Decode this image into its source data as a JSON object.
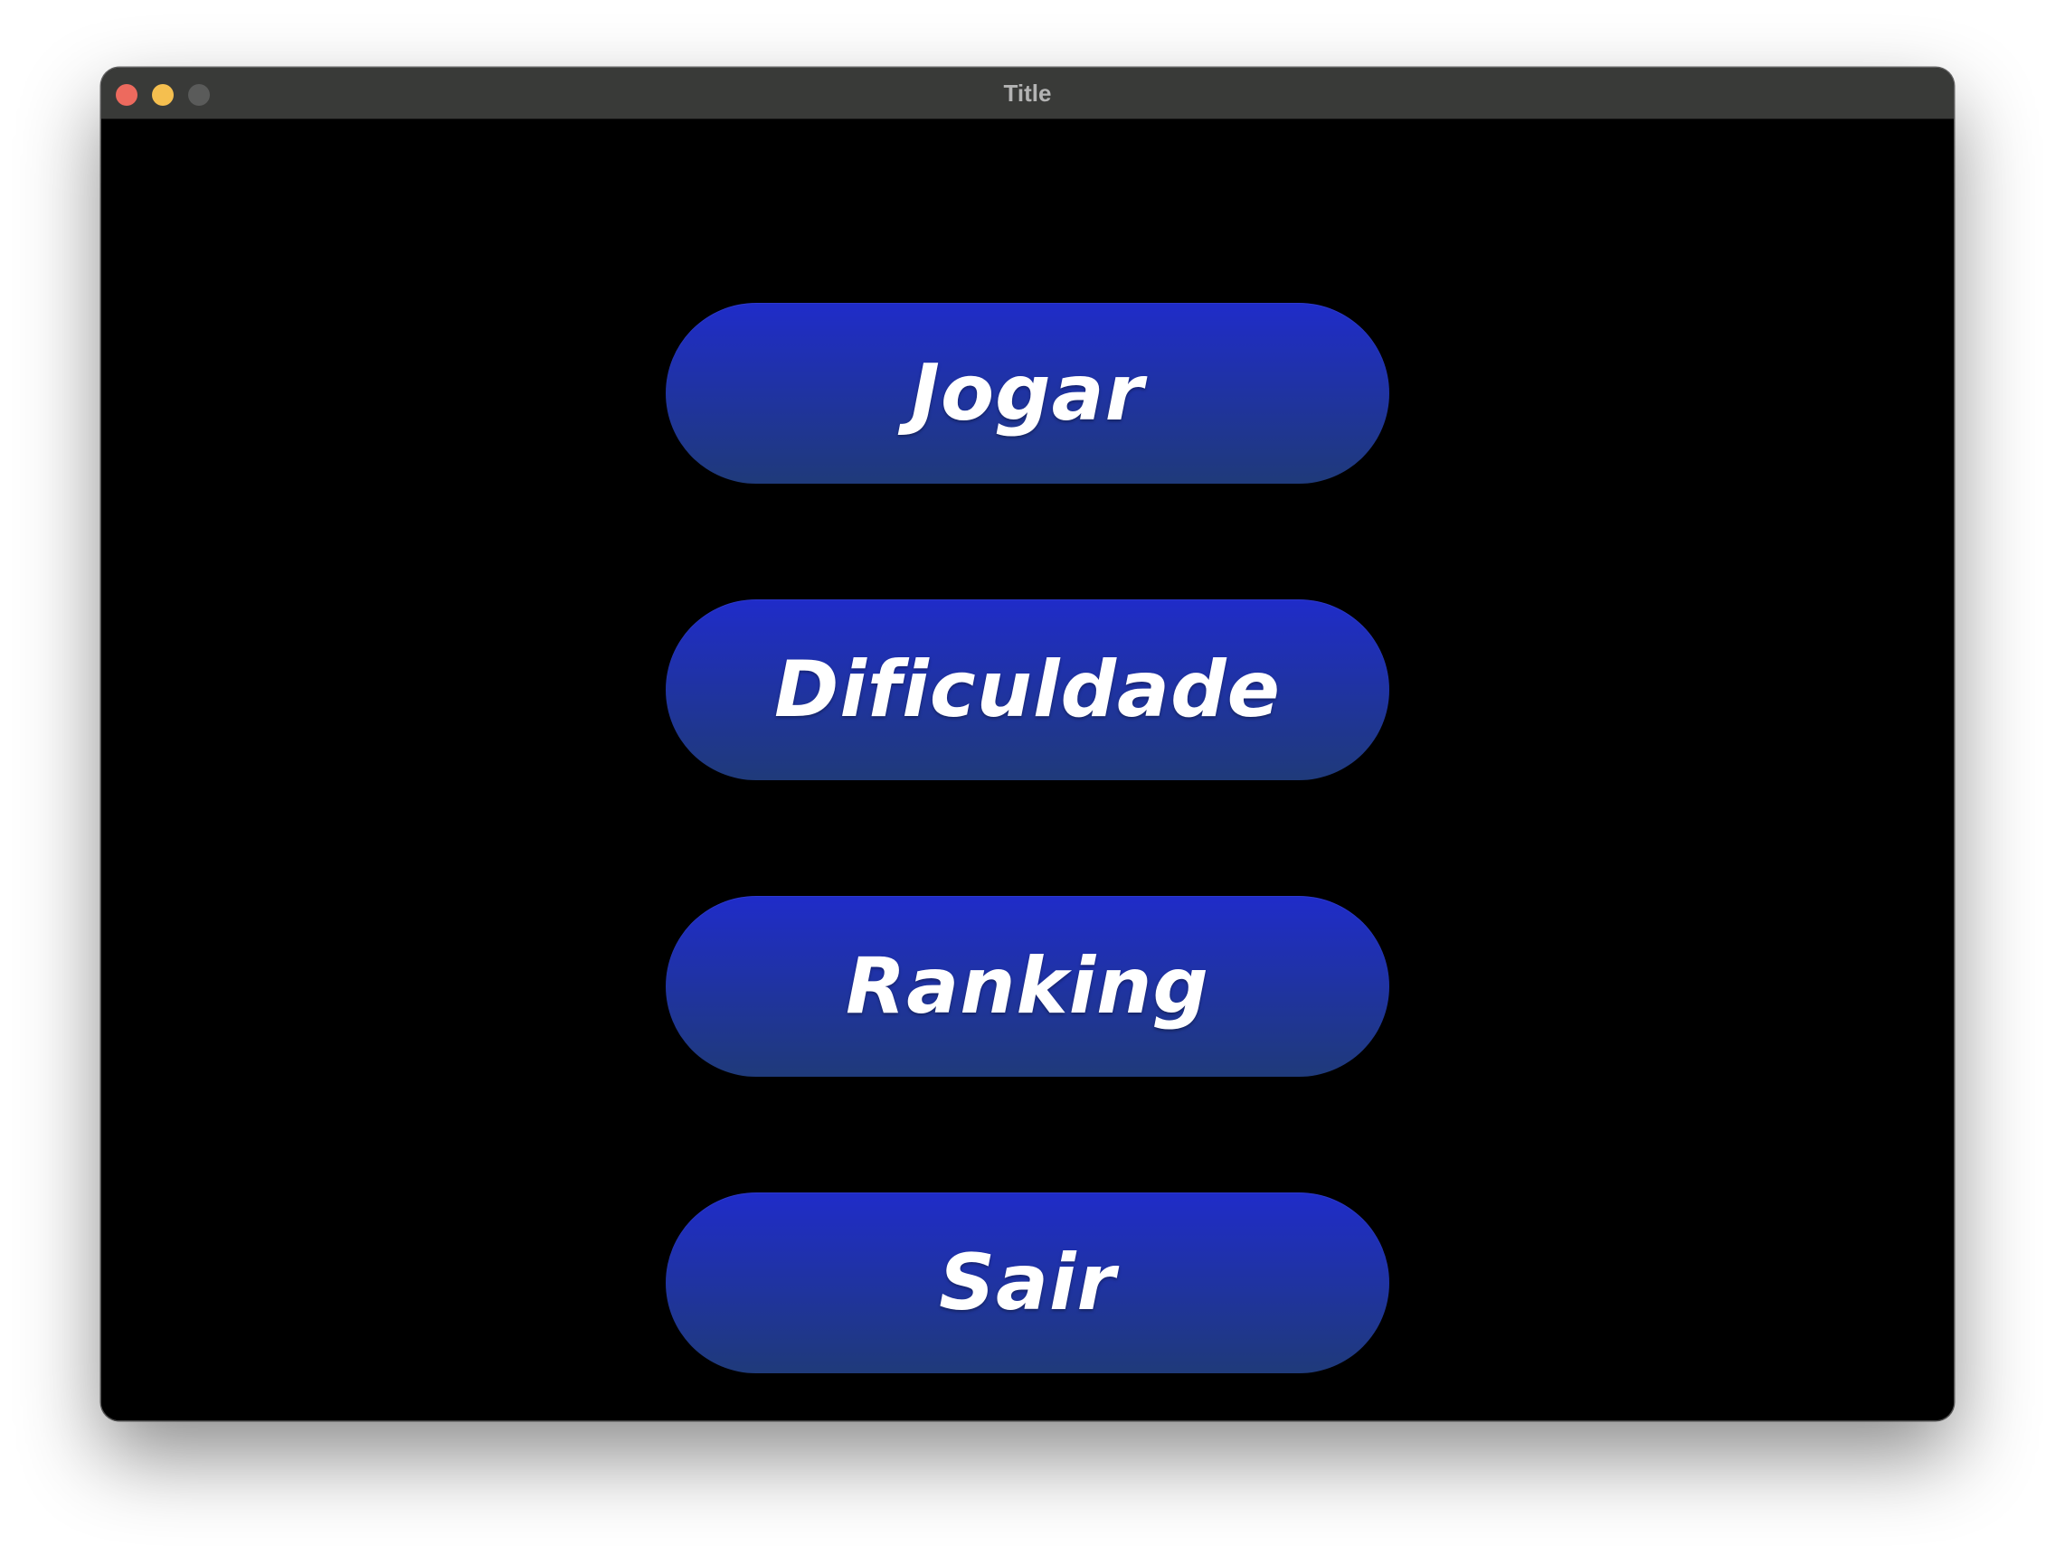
{
  "window": {
    "title": "Title",
    "controls": {
      "close_color": "#ed6a5e",
      "minimize_color": "#f5bf4f",
      "zoom_color": "#5a5b5a"
    }
  },
  "menu": {
    "play_label": "Jogar",
    "difficulty_label": "Dificuldade",
    "ranking_label": "Ranking",
    "exit_label": "Sair"
  },
  "colors": {
    "background": "#000000",
    "button_top": "#1f2cc9",
    "button_bottom": "#1f3a7a",
    "button_text": "#ffffff"
  }
}
